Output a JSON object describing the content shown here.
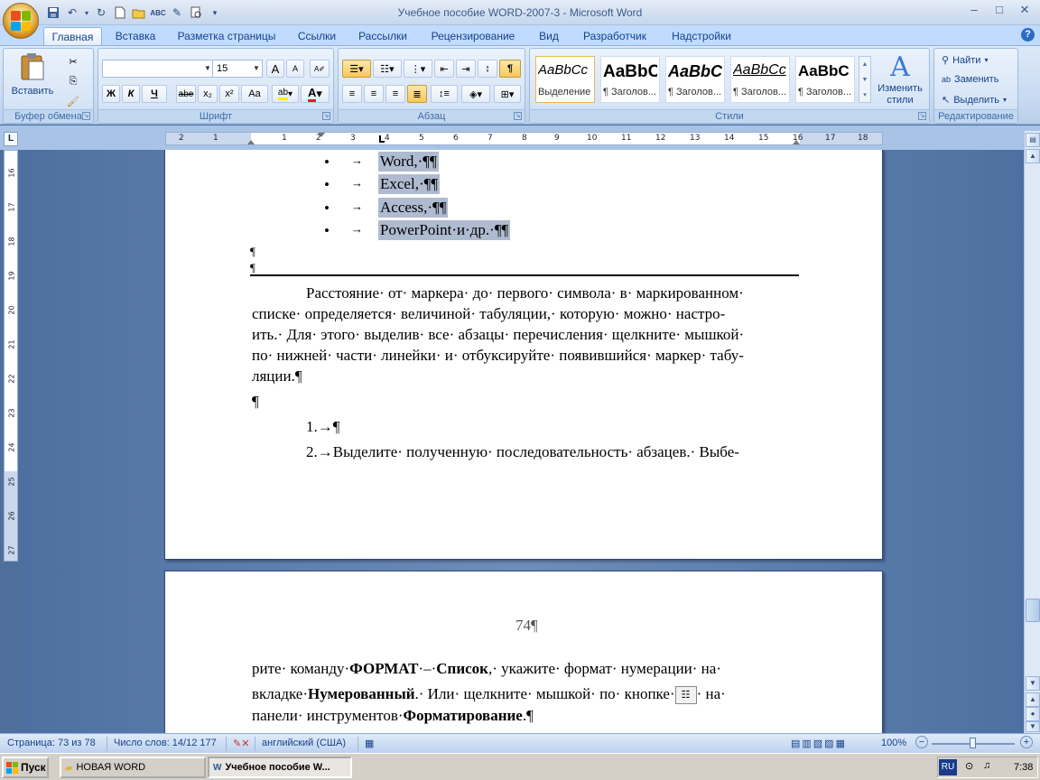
{
  "window": {
    "title": "Учебное пособие WORD-2007-3 - Microsoft Word",
    "minimize": "–",
    "maximize": "□",
    "close": "✕"
  },
  "tabs": [
    "Главная",
    "Вставка",
    "Разметка страницы",
    "Ссылки",
    "Рассылки",
    "Рецензирование",
    "Вид",
    "Разработчик",
    "Надстройки"
  ],
  "ribbon": {
    "clipboard": {
      "label": "Буфер обмена",
      "paste": "Вставить"
    },
    "font": {
      "label": "Шрифт",
      "font_name": "",
      "font_size": "15",
      "bold": "Ж",
      "italic": "К",
      "underline": "Ч",
      "strike": "abe",
      "subscript": "x₂",
      "superscript": "x²",
      "change_case": "Aa",
      "grow": "A",
      "shrink": "A"
    },
    "paragraph": {
      "label": "Абзац"
    },
    "styles": {
      "label": "Стили",
      "items": [
        {
          "sample": "AaBbCc",
          "caption": "Выделение"
        },
        {
          "sample": "AaBbC",
          "caption": "¶ Заголов..."
        },
        {
          "sample": "AaBbC",
          "caption": "¶ Заголов..."
        },
        {
          "sample": "AaBbCc",
          "caption": "¶ Заголов..."
        },
        {
          "sample": "AaBbC",
          "caption": "¶ Заголов..."
        }
      ],
      "change_styles": "Изменить стили"
    },
    "editing": {
      "label": "Редактирование",
      "find": "Найти",
      "replace": "Заменить",
      "select": "Выделить"
    }
  },
  "ruler": {
    "h_marks": [
      "2",
      "1",
      "1",
      "2",
      "3",
      "4",
      "5",
      "6",
      "7",
      "8",
      "9",
      "10",
      "11",
      "12",
      "13",
      "14",
      "15",
      "16",
      "17",
      "18"
    ],
    "v_marks": [
      "16",
      "17",
      "18",
      "19",
      "20",
      "21",
      "22",
      "23",
      "24",
      "25",
      "26",
      "27"
    ]
  },
  "document": {
    "bullets": [
      "Word,·¶¶",
      "Excel,·¶¶",
      "Access,·¶¶",
      "PowerPoint·и·др.·¶¶"
    ],
    "bullet_glyph": "•",
    "tab_arrow": "→",
    "empty_marks": [
      "¶",
      "¶"
    ],
    "para_lines": [
      "Расстояние· от· маркера· до· первого· символа· в· маркированном·",
      "списке· определяется· величиной· табуляции,· которую· можно· настро-",
      "ить.· Для· этого· выделив· все· абзацы· перечисления· щелкните· мышкой·",
      "по· нижней· части· линейки· и· отбуксируйте· появившийся· маркер· табу-",
      "ляции.¶"
    ],
    "empty_mark_3": "¶",
    "num1": "1.→¶",
    "num2": "2.→Выделите· полученную· последовательность· абзацев.· Выбе-",
    "page_number": "74¶",
    "p2_line1_a": "рите· команду·",
    "p2_line1_bold1": "ФОРМАТ",
    "p2_line1_b": "·–·",
    "p2_line1_bold2": "Список",
    "p2_line1_c": ",· укажите· формат· нумерации· на·",
    "p2_line2_a": "вкладке·",
    "p2_line2_bold": "Нумерованный",
    "p2_line2_b": ".· Или· щелкните· мышкой· по· кнопке·",
    "p2_line2_c": "· на·",
    "p2_line3_a": "панели· инструментов·",
    "p2_line3_bold": "Форматирование",
    "p2_line3_b": ".¶"
  },
  "statusbar": {
    "page": "Страница: 73 из 78",
    "words": "Число слов: 14/12 177",
    "language": "английский (США)",
    "zoom": "100%"
  },
  "taskbar": {
    "start": "Пуск",
    "tasks": [
      "НОВАЯ WORD",
      "Учебное пособие W..."
    ],
    "lang": "RU",
    "clock": "7:38"
  },
  "colors": {
    "selection": "#aebbd0",
    "ribbon_text": "#15428b",
    "doc_background": "#6d8dbb"
  }
}
